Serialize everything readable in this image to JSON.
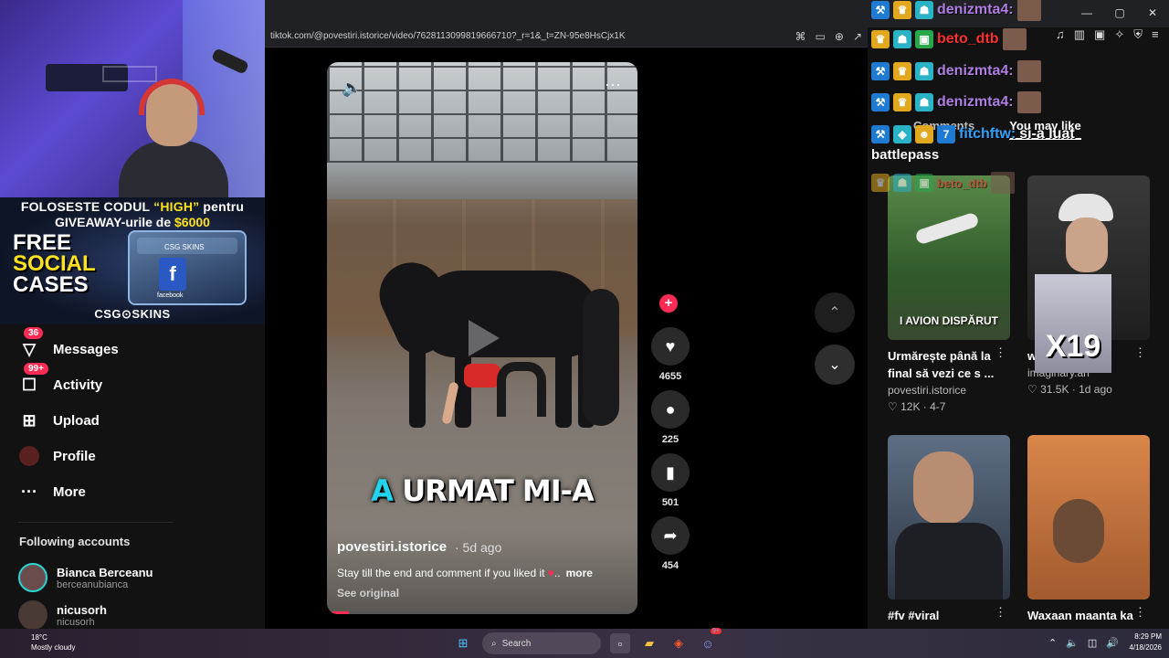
{
  "browser": {
    "url": "tiktok.com/@povestiri.istorice/video/7628113099819666710?_r=1&_t=ZN-95e8HsCjx1K",
    "window_controls": [
      "—",
      "▢",
      "✕"
    ]
  },
  "promo": {
    "line1_pre": "FOLOSESTE CODUL ",
    "line1_code": "“HIGH”",
    "line1_post": " pentru",
    "line2_pre": "GIVEAWAY-urile de ",
    "line2_amount": "$6000",
    "free_l1": "FREE",
    "free_l2": "SOCIAL",
    "free_l3": "CASES",
    "chest_label": "CSG SKINS",
    "chest_fb": "f",
    "chest_fb_text": "facebook",
    "brand": "CSG⊙SKINS"
  },
  "leftnav": {
    "items": [
      {
        "label": "Messages",
        "icon": "send-icon",
        "badge": "36"
      },
      {
        "label": "Activity",
        "icon": "bell-icon",
        "badge": "99+"
      },
      {
        "label": "Upload",
        "icon": "plus-square-icon",
        "badge": ""
      },
      {
        "label": "Profile",
        "icon": "profile-avatar",
        "badge": ""
      },
      {
        "label": "More",
        "icon": "more-icon",
        "badge": ""
      }
    ],
    "following_title": "Following accounts",
    "accounts": [
      {
        "name": "Bianca Berceanu",
        "handle": "berceanubianca"
      },
      {
        "name": "nicusorh",
        "handle": "nicusorh"
      }
    ]
  },
  "video": {
    "caption_a": "A",
    "caption_rest": " URMAT MI-A",
    "author": "povestiri.istorice",
    "ago": "· 5d ago",
    "description": "Stay till the end and comment if you liked it",
    "desc_ellipsis": "..",
    "more": "more",
    "see_original": "See original",
    "progress": 0.07
  },
  "actions": {
    "likes": "4655",
    "comments": "225",
    "saves": "501",
    "shares": "454"
  },
  "rightpanel": {
    "tabs": [
      "Comments",
      "You may like"
    ],
    "cards": [
      {
        "title": "Urmărește până la final să vezi ce s ...",
        "author": "povestiri.istorice",
        "stats": "♡ 12K · 4-7",
        "overlay": "I AVION DISPĂRUT"
      },
      {
        "title": "wa",
        "suffix": "t",
        "author": "imaginary.ah",
        "stats": "♡ 31.5K · 1d ago",
        "overlay": ""
      },
      {
        "title": "#fv #viral",
        "author": "",
        "stats": "",
        "overlay": ""
      },
      {
        "title": "Waxaan maanta ka",
        "author": "",
        "stats": "",
        "overlay": ""
      }
    ]
  },
  "chat": {
    "lines": [
      {
        "user": "denizmta4:",
        "msg": "",
        "color": "purple"
      },
      {
        "user": "beto_dtb",
        "msg": "",
        "color": "red"
      },
      {
        "user": "denizmta4:",
        "msg": "",
        "color": "purple"
      },
      {
        "user": "denizmta4:",
        "msg": "",
        "color": "purple"
      },
      {
        "user": "fitchftw:",
        "msg": "si-a luat",
        "color": "cyan"
      }
    ],
    "battlepass": "battlepass",
    "beto_faint": "beto_dtb"
  },
  "overlay_x19": "X19",
  "taskbar": {
    "temp": "18°C",
    "weather": "Mostly cloudy",
    "search": "Search",
    "time": "8:29 PM",
    "date": "4/18/2026",
    "notif_count": "9+"
  }
}
